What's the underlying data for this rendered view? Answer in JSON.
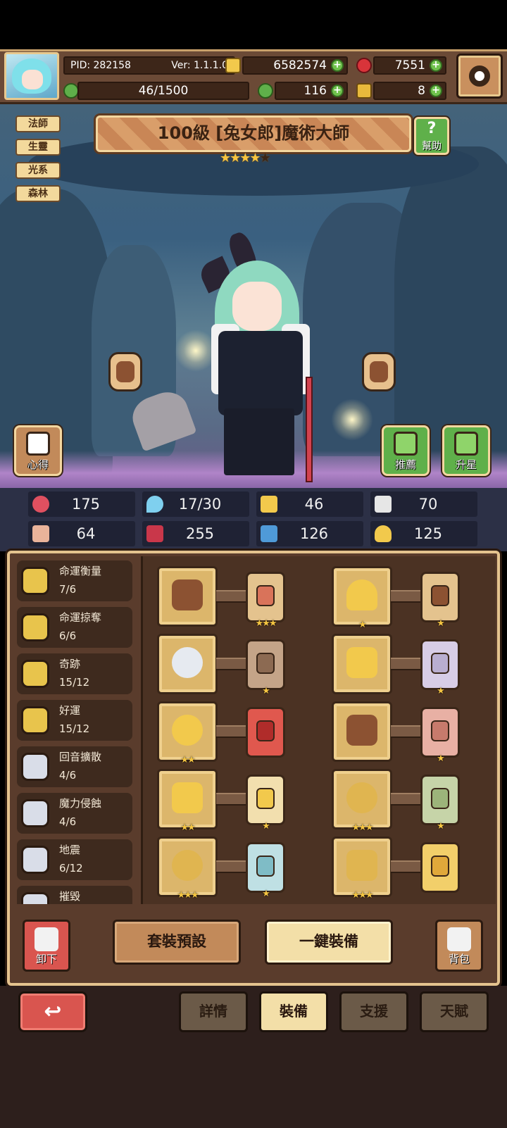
{
  "header": {
    "pid": "PID: 282158",
    "version": "Ver: 1.1.1.0",
    "gold": "6582574",
    "gems": "7551",
    "exp": "46/1500",
    "clover": "116",
    "key": "8"
  },
  "hero": {
    "tags": [
      "法師",
      "生靈",
      "光系",
      "森林"
    ],
    "title": "100級 [兔女郎]魔術大師",
    "stars": "★★★★",
    "stars_total": 5,
    "stars_filled": 4,
    "help_label": "幫助",
    "insight_label": "心得",
    "recommend_label": "推薦",
    "starup_label": "升星"
  },
  "stats": [
    {
      "icon": "heart-icon",
      "value": "175"
    },
    {
      "icon": "mana-drop-icon",
      "value": "17/30"
    },
    {
      "icon": "shield-icon",
      "value": "46"
    },
    {
      "icon": "feather-icon",
      "value": "70"
    },
    {
      "icon": "fist-icon",
      "value": "64"
    },
    {
      "icon": "book-icon",
      "value": "255"
    },
    {
      "icon": "boot-icon",
      "value": "126"
    },
    {
      "icon": "horseshoe-icon",
      "value": "125"
    }
  ],
  "skills": [
    {
      "name": "命運衡量",
      "value": "7/6"
    },
    {
      "name": "命運掠奪",
      "value": "6/6"
    },
    {
      "name": "奇跡",
      "value": "15/12"
    },
    {
      "name": "好運",
      "value": "15/12"
    },
    {
      "name": "回音擴散",
      "value": "4/6"
    },
    {
      "name": "魔力侵蝕",
      "value": "4/6"
    },
    {
      "name": "地震",
      "value": "6/12"
    },
    {
      "name": "摧毀",
      "value": ""
    }
  ],
  "equipment": [
    {
      "item": "staff-icon",
      "item_stars": "",
      "gem": "rune-card-icon",
      "gem_stars": "★★★"
    },
    {
      "item": "golden-crown-icon",
      "item_stars": "★",
      "gem": "bear-card-icon",
      "gem_stars": "★"
    },
    {
      "item": "moon-orb-icon",
      "item_stars": "",
      "gem": "owl-card-icon",
      "gem_stars": "★"
    },
    {
      "item": "golden-armor-icon",
      "item_stars": "",
      "gem": "moon-card-icon",
      "gem_stars": "★"
    },
    {
      "item": "necklace-icon",
      "item_stars": "★★",
      "gem": "red-card-icon",
      "gem_stars": ""
    },
    {
      "item": "hammer-icon",
      "item_stars": "",
      "gem": "pig-card-icon",
      "gem_stars": "★"
    },
    {
      "item": "amulet-icon",
      "item_stars": "★★",
      "gem": "light-card-icon",
      "gem_stars": "★"
    },
    {
      "item": "ring-icon",
      "item_stars": "★★★",
      "gem": "green-card-icon",
      "gem_stars": "★"
    },
    {
      "item": "gem-ring-icon",
      "item_stars": "★★★",
      "gem": "blue-card-icon",
      "gem_stars": "★"
    },
    {
      "item": "boots-icon",
      "item_stars": "★★★",
      "gem": "gold-card-icon",
      "gem_stars": ""
    }
  ],
  "actions": {
    "unequip": "卸下",
    "preset": "套裝預設",
    "auto_equip": "一鍵裝備",
    "bag": "背包"
  },
  "tabs": [
    "詳情",
    "裝備",
    "支援",
    "天賦"
  ],
  "active_tab": "裝備"
}
